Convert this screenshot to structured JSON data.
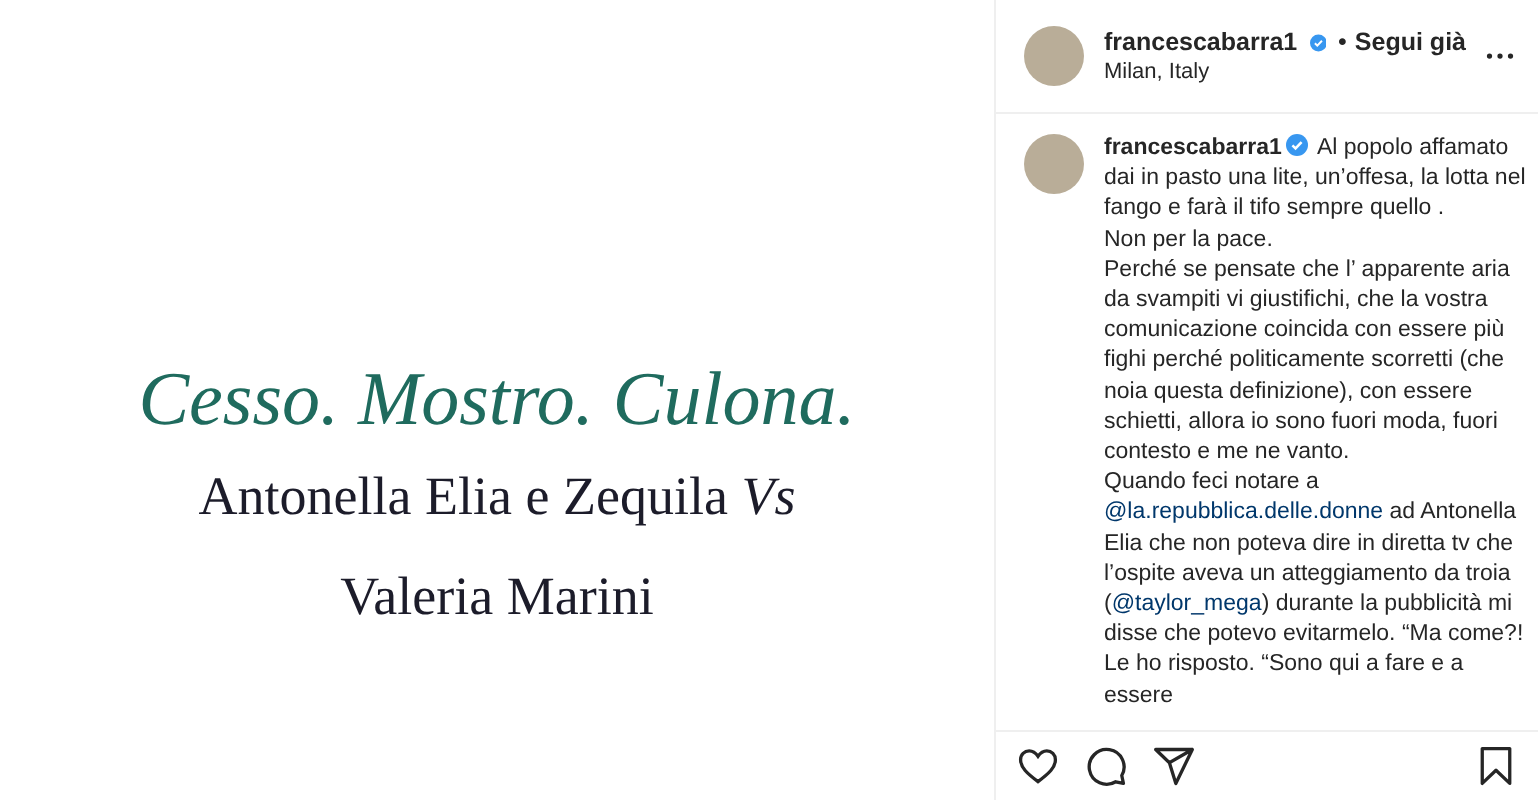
{
  "post_image": {
    "headline": "Cesso. Mostro. Culona.",
    "lines": [
      "Antonella Elia e Zequila *Vs*",
      "Valeria Marini"
    ]
  },
  "header": {
    "username": "francescabarra1",
    "verified": true,
    "separator": "•",
    "follow": "Segui già",
    "location": "Milan, Italy"
  },
  "caption": {
    "username": "francescabarra1",
    "verified": true,
    "parts": [
      {
        "kind": "text",
        "text": "Al popolo affamato dai in pasto una lite, un’offesa, la lotta nel fango e farà il tifo sempre quello .\nNon per la pace.\nPerché se pensate che l’ apparente aria da svampiti vi giustifichi, che la vostra comunicazione coincida con essere più fighi perché politicamente scorretti (che noia questa definizione), con essere schietti, allora io sono fuori moda, fuori contesto e me ne vanto.\nQuando feci notare a "
      },
      {
        "kind": "mention",
        "text": "@la.repubblica.delle.donne"
      },
      {
        "kind": "text",
        "text": " ad Antonella Elia che non poteva dire in diretta tv che l’ospite aveva un atteggiamento da troia ("
      },
      {
        "kind": "mention",
        "text": "@taylor_mega"
      },
      {
        "kind": "text",
        "text": ") durante la pubblicità mi disse che potevo evitarmelo. “Ma come?! Le ho risposto. “Sono qui a fare e a essere"
      }
    ]
  }
}
